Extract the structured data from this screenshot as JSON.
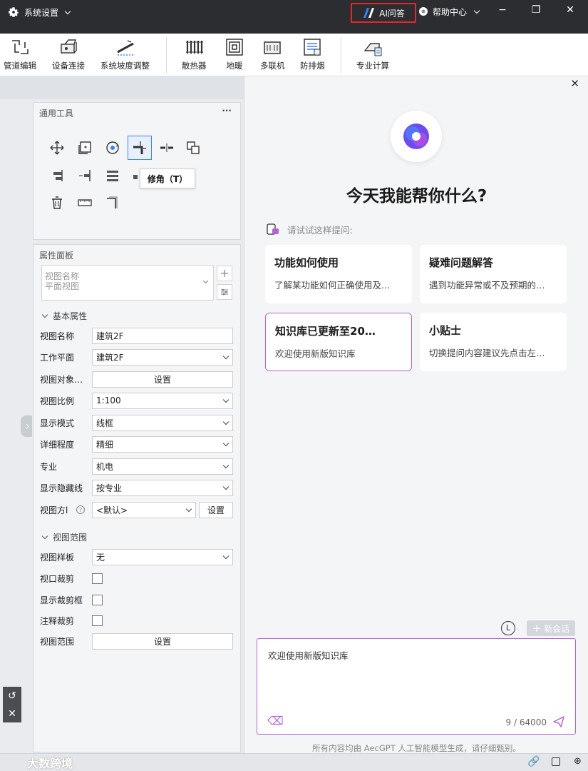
{
  "titlebar": {
    "settings_label": "系统设置",
    "ai_label": "AI问答",
    "help_label": "帮助中心",
    "minimize": "−",
    "restore": "❐",
    "close": "✕"
  },
  "toolbar": {
    "items": [
      "管道编辑",
      "设备连接",
      "系统坡度调整",
      "散热器",
      "地暖",
      "多联机",
      "防排烟",
      "专业计算"
    ]
  },
  "tools_panel": {
    "title": "通用工具",
    "more": "···",
    "tooltip": "修角（T）"
  },
  "property_panel": {
    "title": "属性面板",
    "view_selector": [
      "视图名称",
      "平面视图"
    ],
    "basic_section": "基本属性",
    "rows": [
      {
        "label": "视图名称",
        "value": "建筑2F"
      },
      {
        "label": "工作平面",
        "value": "建筑2F"
      },
      {
        "label": "视图对象…",
        "value": "设置"
      },
      {
        "label": "视图比例",
        "value": "1:100"
      },
      {
        "label": "显示模式",
        "value": "线框"
      },
      {
        "label": "详细程度",
        "value": "精细"
      },
      {
        "label": "专业",
        "value": "机电"
      },
      {
        "label": "显示隐藏线",
        "value": "按专业"
      },
      {
        "label": "视图方l",
        "value": "<默认>",
        "button": "设置"
      }
    ],
    "range_section": "视图范围",
    "range_rows": [
      {
        "label": "视图样板",
        "value": "无"
      },
      {
        "label": "视口裁剪"
      },
      {
        "label": "显示裁剪框"
      },
      {
        "label": "注释裁剪"
      },
      {
        "label": "视图范围",
        "value": "设置"
      }
    ]
  },
  "chat": {
    "heading": "今天我能帮你什么?",
    "suggest_label": "请试试这样提问:",
    "cards": [
      {
        "title": "功能如何使用",
        "desc": "了解某功能如何正确使用及…"
      },
      {
        "title": "疑难问题解答",
        "desc": "遇到功能异常或不及预期的…"
      },
      {
        "title": "知识库已更新至20…",
        "desc": "欢迎使用新版知识库"
      },
      {
        "title": "小贴士",
        "desc": "切换提问内容建议先点击左…"
      }
    ],
    "new_session": "新会话",
    "input_text": "欢迎使用新版知识库",
    "counter": "9 / 64000",
    "disclaimer": "所有内容均由 AecGPT 人工智能模型生成，请仔细甄别。"
  },
  "watermark": "大数跨境",
  "colors": {
    "accent": "#b562d6",
    "titlebar": "#2b2d30",
    "highlight": "#e5262a"
  }
}
